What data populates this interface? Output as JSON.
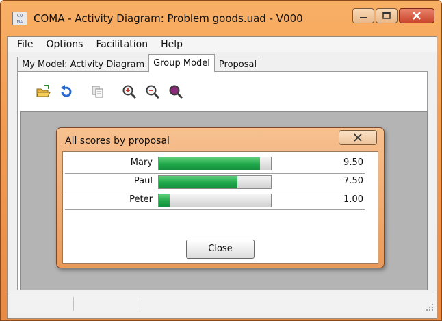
{
  "window": {
    "app_icon_text": "CO\nMA",
    "title": "COMA - Activity Diagram: Problem goods.uad - V000"
  },
  "menu": [
    "File",
    "Options",
    "Facilitation",
    "Help"
  ],
  "tabs": [
    {
      "label": "My Model: Activity Diagram",
      "active": false
    },
    {
      "label": "Group Model",
      "active": true
    },
    {
      "label": "Proposal",
      "active": false
    }
  ],
  "toolbar": {
    "icons": [
      "open-folder-icon",
      "refresh-icon",
      "copy-icon",
      "zoom-in-icon",
      "zoom-out-icon",
      "zoom-fit-icon"
    ]
  },
  "dialog": {
    "title": "All scores by proposal",
    "close_label": "Close",
    "max_score": 10,
    "rows": [
      {
        "name": "Mary",
        "score_text": "9.50",
        "fill_fraction": 0.9
      },
      {
        "name": "Paul",
        "score_text": "7.50",
        "fill_fraction": 0.7
      },
      {
        "name": "Peter",
        "score_text": "1.00",
        "fill_fraction": 0.1
      }
    ]
  },
  "colors": {
    "title_bar": "#f39b52",
    "bar_fill": "#1fa84a",
    "canvas": "#b4b4b4"
  }
}
